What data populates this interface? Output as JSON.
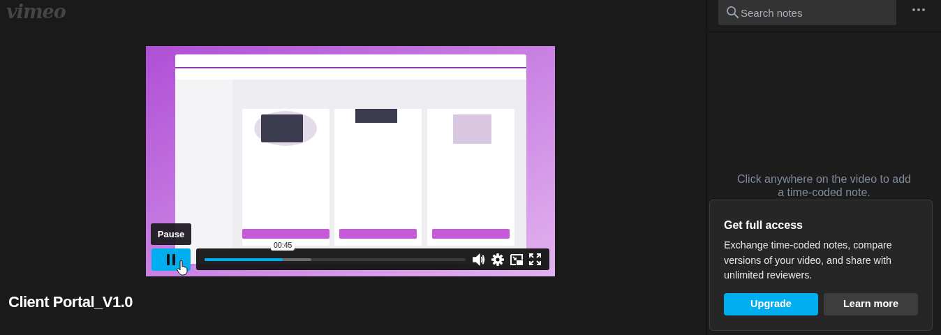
{
  "logo": {
    "text": "vimeo"
  },
  "player": {
    "tooltip": "Pause",
    "playing": true,
    "progress": {
      "level": 0.3,
      "time": "00:45"
    },
    "buffer": {
      "level": 0.41
    }
  },
  "video_title": "Client Portal_V1.0",
  "notes_panel": {
    "search": {
      "placeholder": "Search notes"
    },
    "empty_hint": "Click anywhere on the video to add a time-coded note."
  },
  "promo": {
    "title": "Get full access",
    "text": "Exchange time-coded notes, compare versions of your video, and share with unlimited reviewers.",
    "buttons": [
      {
        "label": "Upgrade",
        "kind": "primary"
      },
      {
        "label": "Learn more",
        "kind": "secondary"
      }
    ]
  }
}
